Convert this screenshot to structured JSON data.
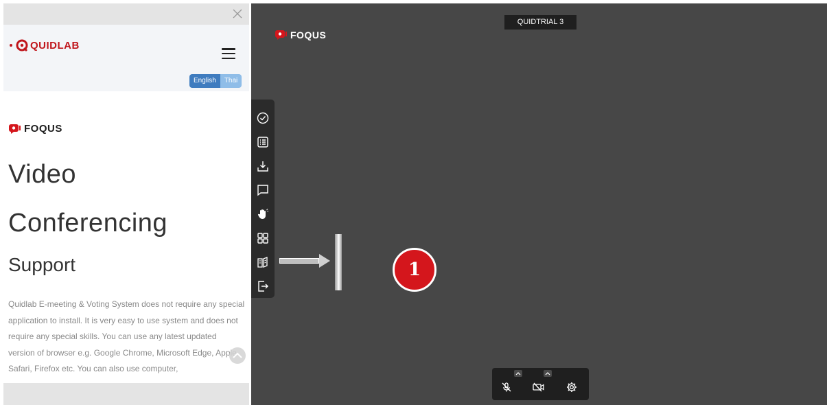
{
  "side_panel": {
    "brand_name": "QUIDLAB",
    "language": {
      "english": "English",
      "thai": "Thai"
    },
    "product_logo": "FOQUS",
    "heading_line1": "Video",
    "heading_line2": "Conferencing",
    "subheading": "Support",
    "body": "Quidlab E-meeting & Voting System does not require any special application to install. It is very easy to use system and does not require any special skills. You can use any latest updated version of browser e.g. Google Chrome, Microsoft Edge, Apple Safari, Firefox etc. You can also use computer,"
  },
  "main": {
    "meeting_title": "QUIDTRIAL 3",
    "product_logo": "FOQUS",
    "step_badge": "1"
  },
  "toolbar_icons": [
    "check-circle-icon",
    "list-icon",
    "download-icon",
    "chat-icon",
    "raise-hand-icon",
    "grid-icon",
    "book-icon",
    "exit-icon"
  ],
  "controls_icons": [
    "mic-off-icon",
    "camera-off-icon",
    "settings-gear-icon"
  ],
  "colors": {
    "brand_red": "#d4161c",
    "main_background": "#474747",
    "toolbar_background": "#2b2b2b",
    "language_english": "#3f7cbf",
    "language_thai": "#8fbde8"
  }
}
